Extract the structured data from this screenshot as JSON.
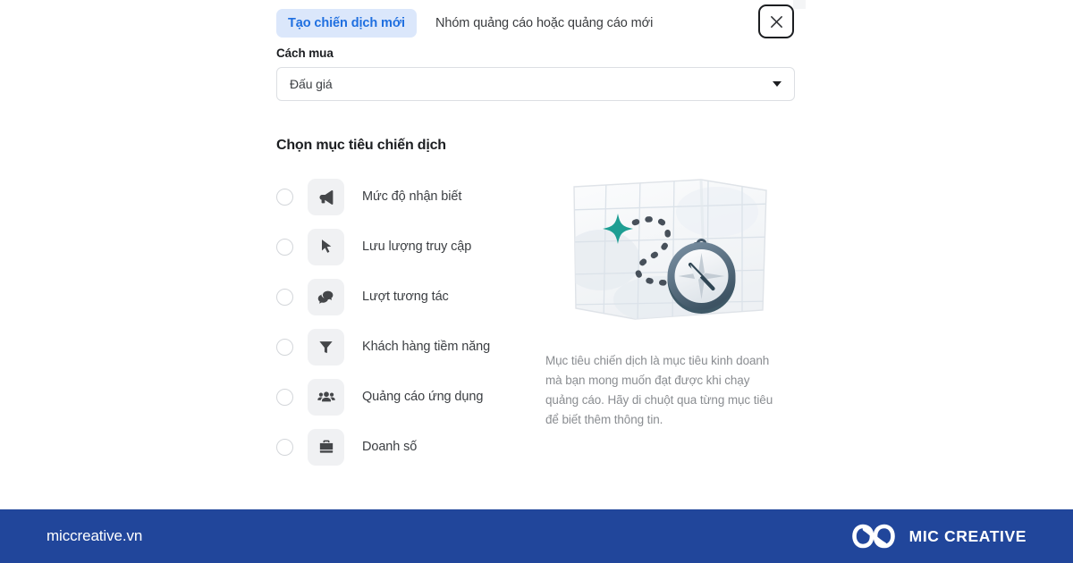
{
  "tabs": {
    "active_label": "Tạo chiến dịch mới",
    "inactive_label": "Nhóm quảng cáo hoặc quảng cáo mới"
  },
  "close_button": {
    "name": "close-icon",
    "label": "×"
  },
  "buying_type": {
    "label": "Cách mua",
    "value": "Đấu giá",
    "caret_icon": "chevron-down-icon"
  },
  "objectives_section": {
    "title": "Chọn mục tiêu chiến dịch",
    "items": [
      {
        "label": "Mức độ nhận biết",
        "icon": "megaphone-icon",
        "selected": false
      },
      {
        "label": "Lưu lượng truy cập",
        "icon": "cursor-arrow-icon",
        "selected": false
      },
      {
        "label": "Lượt tương tác",
        "icon": "chat-bubbles-icon",
        "selected": false
      },
      {
        "label": "Khách hàng tiềm năng",
        "icon": "funnel-icon",
        "selected": false
      },
      {
        "label": "Quảng cáo ứng dụng",
        "icon": "people-group-icon",
        "selected": false
      },
      {
        "label": "Doanh số",
        "icon": "briefcase-icon",
        "selected": false
      }
    ]
  },
  "info_panel": {
    "illustration": "map-with-compass-illustration",
    "description": "Mục tiêu chiến dịch là mục tiêu kinh doanh mà bạn mong muốn đạt được khi chạy quảng cáo. Hãy di chuột qua từng mục tiêu để biết thêm thông tin."
  },
  "footer": {
    "url": "miccreative.vn",
    "brand_name": "MIC CREATIVE",
    "logo_icon": "infinity-loop-logo",
    "background_color": "#21469b"
  },
  "colors": {
    "accent_blue": "#1f6fe0",
    "active_tab_bg": "#dbe7fb",
    "footer_blue": "#21469b",
    "illustration_teal": "#1e9e93",
    "icon_tile_bg": "#f0f1f3",
    "text_primary": "#1c1e21",
    "text_muted": "#8a8d91"
  }
}
